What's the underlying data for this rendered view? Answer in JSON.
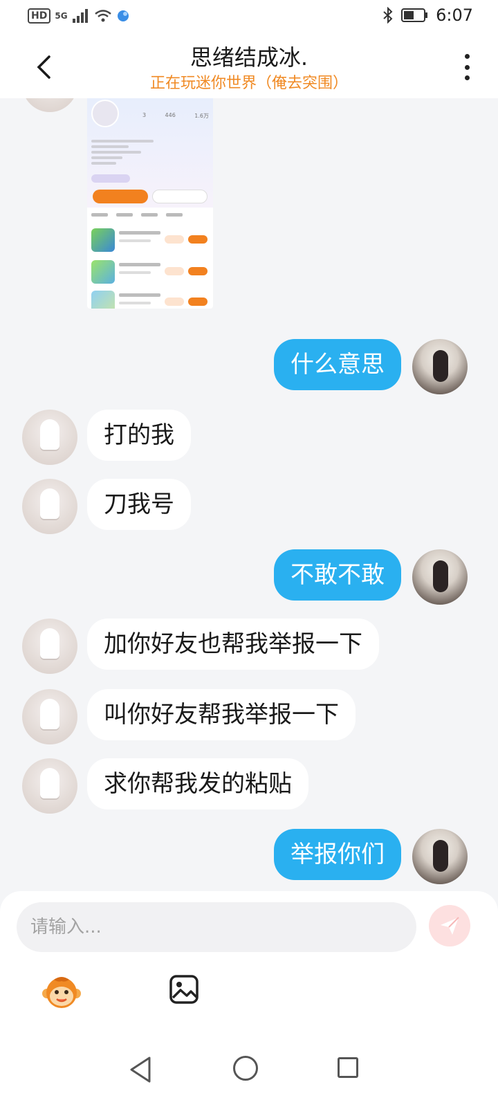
{
  "status_bar": {
    "network_badge": "HD",
    "network_type": "5G",
    "time": "6:07",
    "icons": [
      "signal-icon",
      "wifi-icon",
      "app-notification-icon",
      "bluetooth-icon",
      "battery-icon"
    ]
  },
  "header": {
    "title": "思绪结成冰.",
    "subtitle": "正在玩迷你世界（俺去突围）"
  },
  "shared_image": {
    "description": "profile-screenshot",
    "stats": [
      "3",
      "446",
      "1.6万"
    ]
  },
  "messages": [
    {
      "from": "me",
      "text": "什么意思"
    },
    {
      "from": "other",
      "text": "打的我"
    },
    {
      "from": "other",
      "text": "刀我号"
    },
    {
      "from": "me",
      "text": "不敢不敢"
    },
    {
      "from": "other",
      "text": "加你好友也帮我举报一下"
    },
    {
      "from": "other",
      "text": "叫你好友帮我举报一下"
    },
    {
      "from": "other",
      "text": "求你帮我发的粘贴"
    },
    {
      "from": "me",
      "text": "举报你们"
    }
  ],
  "composer": {
    "placeholder": "请输入..."
  },
  "colors": {
    "outgoing_bubble": "#2ab0f0",
    "incoming_bubble": "#ffffff",
    "subtitle": "#f08a24",
    "background": "#f4f5f7",
    "send_button": "#fde0e0"
  }
}
